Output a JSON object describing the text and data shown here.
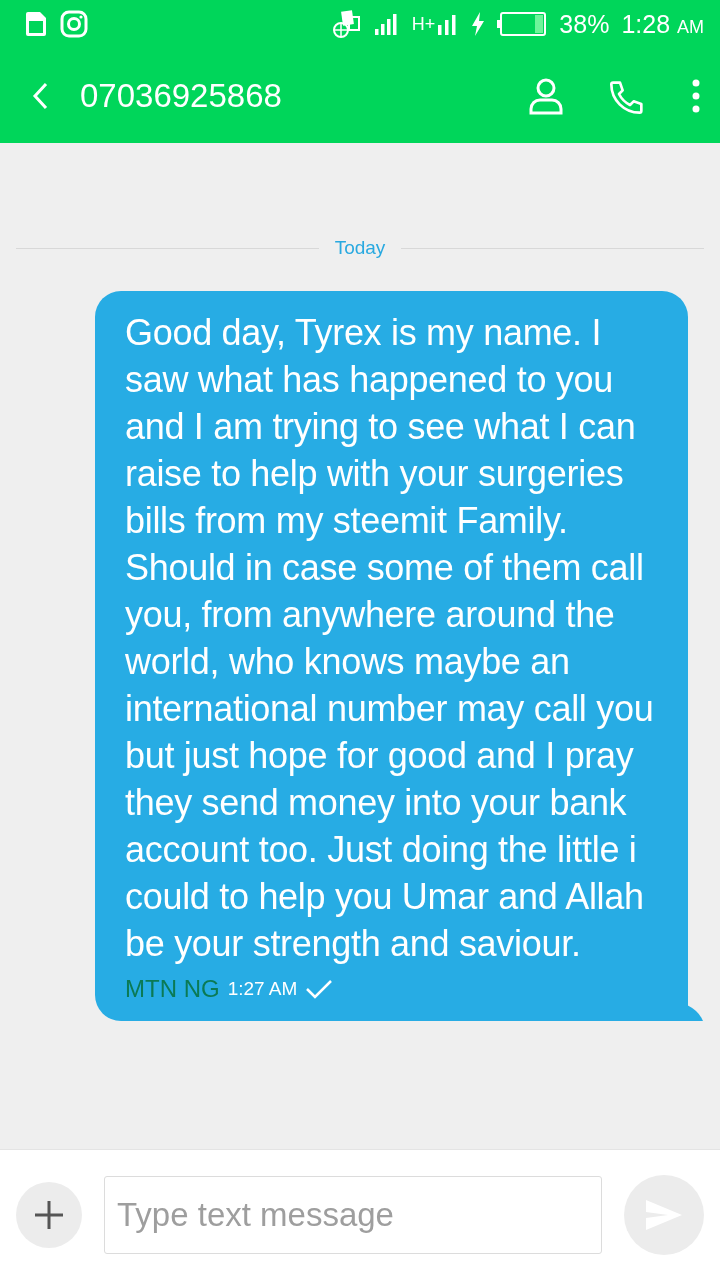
{
  "status_bar": {
    "battery_percent": "38%",
    "time": "1:28",
    "time_suffix": "AM",
    "network": "H+"
  },
  "header": {
    "title": "07036925868"
  },
  "date_divider": "Today",
  "messages": [
    {
      "text": "Good day, Tyrex is my name. I saw what has happened to you and I am trying to see what I can raise to help with your surgeries bills from my steemit Family. Should in case some of them call you, from anywhere around the world, who knows maybe an international number may call you but just hope for good and I pray they send money into your bank account too. Just doing the little i could to help you Umar and Allah be your strength and saviour.",
      "sim": "MTN NG",
      "time": "1:27 AM"
    }
  ],
  "composer": {
    "placeholder": "Type text message"
  }
}
